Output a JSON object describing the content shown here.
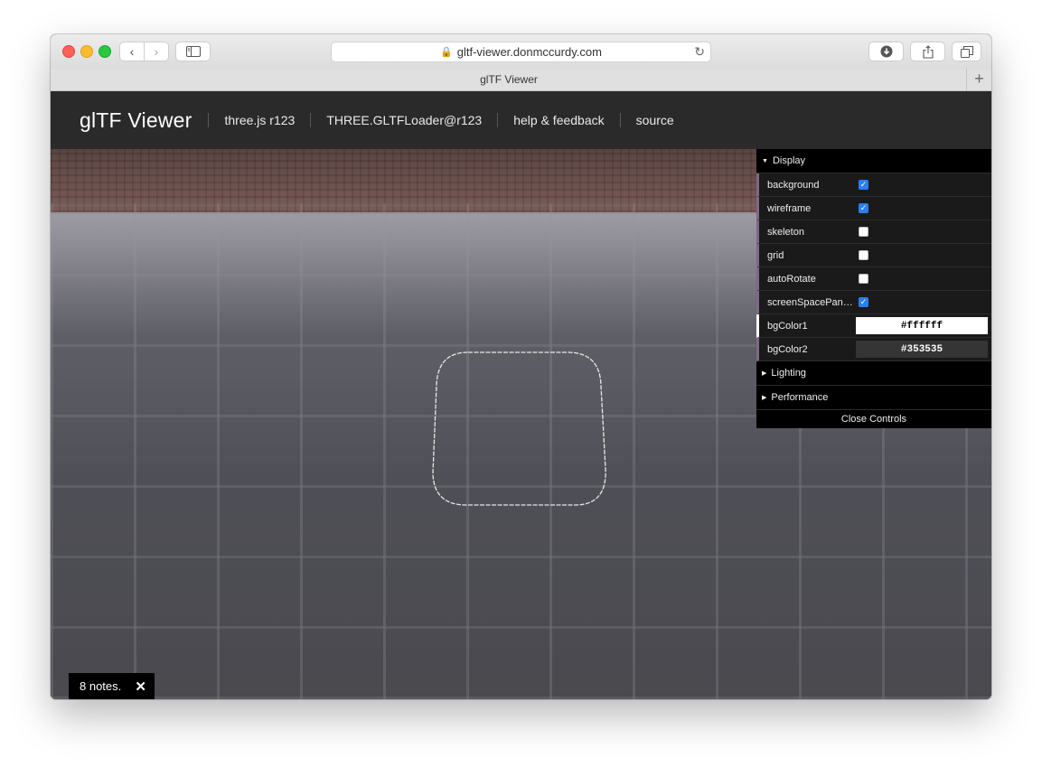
{
  "browser": {
    "url": "gltf-viewer.donmccurdy.com",
    "tab_title": "glTF Viewer",
    "new_tab_glyph": "+"
  },
  "header": {
    "brand": "glTF Viewer",
    "links": [
      "three.js r123",
      "THREE.GLTFLoader@r123",
      "help & feedback",
      "source"
    ]
  },
  "gui": {
    "display_folder": "Display",
    "rows": [
      {
        "label": "background",
        "checked": true
      },
      {
        "label": "wireframe",
        "checked": true
      },
      {
        "label": "skeleton",
        "checked": false
      },
      {
        "label": "grid",
        "checked": false
      },
      {
        "label": "autoRotate",
        "checked": false
      },
      {
        "label": "screenSpacePan…",
        "checked": true
      }
    ],
    "colors": [
      {
        "label": "bgColor1",
        "value": "#ffffff",
        "text_color": "#000000"
      },
      {
        "label": "bgColor2",
        "value": "#353535",
        "text_color": "#ffffff"
      }
    ],
    "folders": [
      "Lighting",
      "Performance"
    ],
    "close": "Close Controls"
  },
  "notes": {
    "text": "8 notes.",
    "close_glyph": "✕"
  },
  "accent": "#2a7ff0"
}
